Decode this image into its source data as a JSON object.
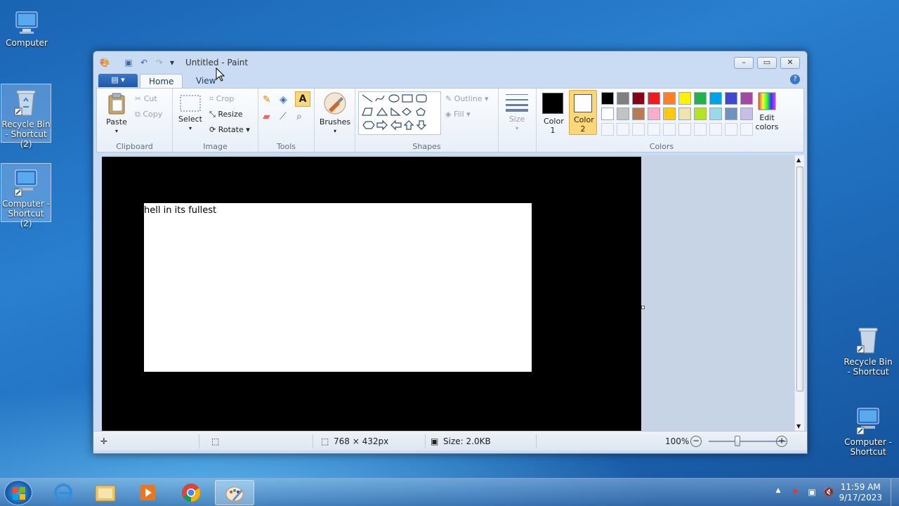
{
  "desktop": {
    "icons": [
      {
        "label": "Computer"
      },
      {
        "label": "Recycle Bin - Shortcut (2)"
      },
      {
        "label": "Computer - Shortcut (2)"
      },
      {
        "label": "Recycle Bin - Shortcut"
      },
      {
        "label": "Computer - Shortcut"
      }
    ]
  },
  "window": {
    "title": "Untitled - Paint",
    "tabs": [
      "Home",
      "View"
    ],
    "ribbon": {
      "clipboard": {
        "paste": "Paste",
        "cut": "Cut",
        "copy": "Copy",
        "group": "Clipboard"
      },
      "image": {
        "select": "Select",
        "crop": "Crop",
        "resize": "Resize",
        "rotate": "Rotate",
        "group": "Image"
      },
      "tools": {
        "group": "Tools"
      },
      "brushes": {
        "label": "Brushes"
      },
      "shapes": {
        "outline": "Outline",
        "fill": "Fill",
        "group": "Shapes"
      },
      "size": {
        "label": "Size"
      },
      "colors": {
        "color1": "Color 1",
        "color2": "Color 2",
        "edit": "Edit colors",
        "group": "Colors",
        "color1_value": "#000000",
        "color2_value": "#ffffff",
        "palette_row1": [
          "#000000",
          "#7f7f7f",
          "#880015",
          "#ed1c24",
          "#ff7f27",
          "#fff200",
          "#22b14c",
          "#00a2e8",
          "#3f48cc",
          "#a349a4"
        ],
        "palette_row2": [
          "#ffffff",
          "#c3c3c3",
          "#b97a57",
          "#ffaec9",
          "#ffc90e",
          "#efe4b0",
          "#b5e61d",
          "#99d9ea",
          "#7092be",
          "#c8bfe7"
        ]
      }
    },
    "canvas": {
      "text": "hell in its fullest"
    },
    "status": {
      "dimensions": "768 × 432px",
      "size": "Size: 2.0KB",
      "zoom": "100%"
    }
  },
  "taskbar": {
    "time": "11:59 AM",
    "date": "9/17/2023"
  }
}
